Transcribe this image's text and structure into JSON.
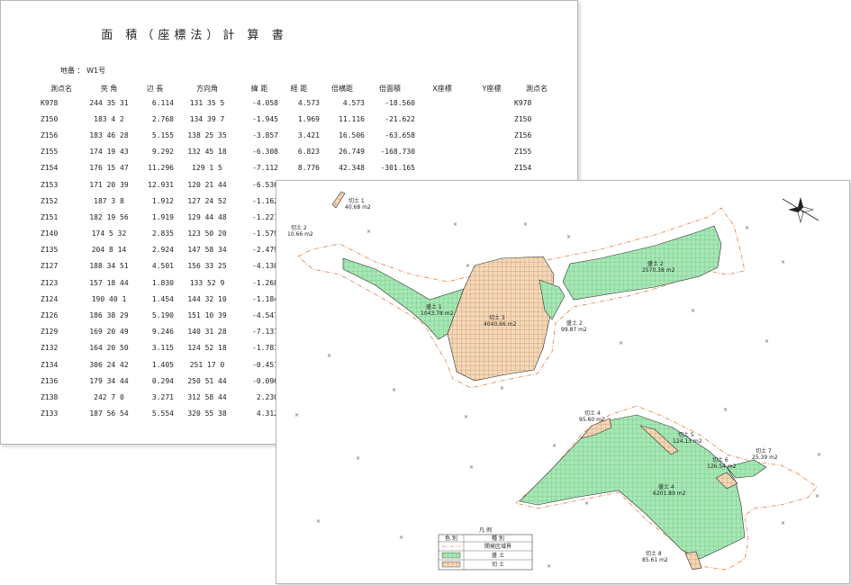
{
  "calc": {
    "title": "面 積（座標法）計 算 書",
    "lot_label": "地番 ： W1号",
    "headers": [
      "測点名",
      "夾 角",
      "辺 長",
      "方向角",
      "緯 距",
      "経 距",
      "倍横距",
      "倍面積",
      "X座標",
      "Y座標",
      "測点名"
    ],
    "rows": [
      {
        "name": "K978",
        "angle": "244 35 31",
        "side": "6.114",
        "dir": "131 35  5",
        "lat": "-4.058",
        "dep": "4.573",
        "dmd": "4.573",
        "area": "-18.560",
        "x": "",
        "y": "",
        "name2": "K978"
      },
      {
        "name": "Z150",
        "angle": "183  4  2",
        "side": "2.768",
        "dir": "134 39  7",
        "lat": "-1.945",
        "dep": "1.969",
        "dmd": "11.116",
        "area": "-21.622",
        "x": "",
        "y": "",
        "name2": "Z150"
      },
      {
        "name": "Z156",
        "angle": "183 46 28",
        "side": "5.155",
        "dir": "138 25 35",
        "lat": "-3.857",
        "dep": "3.421",
        "dmd": "16.506",
        "area": "-63.658",
        "x": "",
        "y": "",
        "name2": "Z156"
      },
      {
        "name": "Z155",
        "angle": "174 19 43",
        "side": "9.292",
        "dir": "132 45 18",
        "lat": "-6.308",
        "dep": "6.823",
        "dmd": "26.749",
        "area": "-168.730",
        "x": "",
        "y": "",
        "name2": "Z155"
      },
      {
        "name": "Z154",
        "angle": "176 15 47",
        "side": "11.296",
        "dir": "129  1  5",
        "lat": "-7.112",
        "dep": "8.776",
        "dmd": "42.348",
        "area": "-301.165",
        "x": "",
        "y": "",
        "name2": "Z154"
      },
      {
        "name": "Z153",
        "angle": "171 20 39",
        "side": "12.931",
        "dir": "120 21 44",
        "lat": "-6.536",
        "dep": "",
        "dmd": "",
        "area": "",
        "x": "",
        "y": "",
        "name2": ""
      },
      {
        "name": "Z152",
        "angle": "187  3  8",
        "side": "1.912",
        "dir": "127 24 52",
        "lat": "-1.162",
        "dep": "",
        "dmd": "",
        "area": "",
        "x": "",
        "y": "",
        "name2": ""
      },
      {
        "name": "Z151",
        "angle": "182 19 56",
        "side": "1.919",
        "dir": "129 44 48",
        "lat": "-1.227",
        "dep": "",
        "dmd": "",
        "area": "",
        "x": "",
        "y": "",
        "name2": ""
      },
      {
        "name": "Z140",
        "angle": "174  5 32",
        "side": "2.835",
        "dir": "123 50 20",
        "lat": "-1.579",
        "dep": "",
        "dmd": "",
        "area": "",
        "x": "",
        "y": "",
        "name2": ""
      },
      {
        "name": "Z135",
        "angle": "204  8 14",
        "side": "2.924",
        "dir": "147 58 34",
        "lat": "-2.479",
        "dep": "",
        "dmd": "",
        "area": "",
        "x": "",
        "y": "",
        "name2": ""
      },
      {
        "name": "Z127",
        "angle": "188 34 51",
        "side": "4.501",
        "dir": "156 33 25",
        "lat": "-4.130",
        "dep": "",
        "dmd": "",
        "area": "",
        "x": "",
        "y": "",
        "name2": ""
      },
      {
        "name": "Z123",
        "angle": "157 18 44",
        "side": "1.830",
        "dir": "133 52  9",
        "lat": "-1.268",
        "dep": "",
        "dmd": "",
        "area": "",
        "x": "",
        "y": "",
        "name2": ""
      },
      {
        "name": "Z124",
        "angle": "190 40  1",
        "side": "1.454",
        "dir": "144 32 10",
        "lat": "-1.184",
        "dep": "",
        "dmd": "",
        "area": "",
        "x": "",
        "y": "",
        "name2": ""
      },
      {
        "name": "Z126",
        "angle": "186 38 29",
        "side": "5.190",
        "dir": "151 10 39",
        "lat": "-4.547",
        "dep": "",
        "dmd": "",
        "area": "",
        "x": "",
        "y": "",
        "name2": ""
      },
      {
        "name": "Z129",
        "angle": "169 20 49",
        "side": "9.246",
        "dir": "140 31 28",
        "lat": "-7.137",
        "dep": "",
        "dmd": "",
        "area": "",
        "x": "",
        "y": "",
        "name2": ""
      },
      {
        "name": "Z132",
        "angle": "164 20 50",
        "side": "3.115",
        "dir": "124 52 18",
        "lat": "-1.781",
        "dep": "",
        "dmd": "",
        "area": "",
        "x": "",
        "y": "",
        "name2": ""
      },
      {
        "name": "Z134",
        "angle": "306 24 42",
        "side": "1.405",
        "dir": "251 17  0",
        "lat": "-0.451",
        "dep": "",
        "dmd": "",
        "area": "",
        "x": "",
        "y": "",
        "name2": ""
      },
      {
        "name": "Z136",
        "angle": "179 34 44",
        "side": "0.294",
        "dir": "250 51 44",
        "lat": "-0.096",
        "dep": "",
        "dmd": "",
        "area": "",
        "x": "",
        "y": "",
        "name2": ""
      },
      {
        "name": "Z138",
        "angle": "242  7  0",
        "side": "3.271",
        "dir": "312 58 44",
        "lat": "2.230",
        "dep": "",
        "dmd": "",
        "area": "",
        "x": "",
        "y": "",
        "name2": ""
      },
      {
        "name": "Z133",
        "angle": "187 56 54",
        "side": "5.554",
        "dir": "320 55 38",
        "lat": "4.312",
        "dep": "",
        "dmd": "",
        "area": "",
        "x": "",
        "y": "",
        "name2": ""
      }
    ]
  },
  "map": {
    "labels": {
      "cut1": "切土 1",
      "cut1_area": "40.68 m2",
      "cut2": "切土 2",
      "cut2_area": "10.66 m2",
      "fill2": "盛土 2",
      "fill2_area": "2570.38 m2",
      "fill1": "盛土 1",
      "fill1_area": "1043.78 m2",
      "cut3": "切土 3",
      "cut3_area": "4040.66 m2",
      "fill3": "盛土 2",
      "fill3_area": "99.87 m2",
      "cut4": "切土 4",
      "cut4_area": "95.60 m2",
      "cut5": "切土 5",
      "cut5_area": "124.13 m2",
      "cut6": "切土 6",
      "cut6_area": "126.54 m2",
      "cut7": "切土 7",
      "cut7_area": "25.39 m2",
      "fill4": "盛土 4",
      "fill4_area": "6201.89 m2",
      "cut8": "切土 8",
      "cut8_area": "85.61 m2"
    },
    "legend": {
      "title": "凡 例",
      "col_color": "色 別",
      "col_kind": "種 別",
      "row1": "開発区域界",
      "row2": "盛 土",
      "row3": "切 土"
    },
    "colors": {
      "fill": "#a8e6b6",
      "fill_grid": "#4cbb62",
      "cut": "#f2d8b8",
      "cut_grid": "#c0703c",
      "boundary": "#e0824a"
    },
    "x_mark": "×",
    "icons": {
      "compass": "compass-rose-icon"
    }
  }
}
